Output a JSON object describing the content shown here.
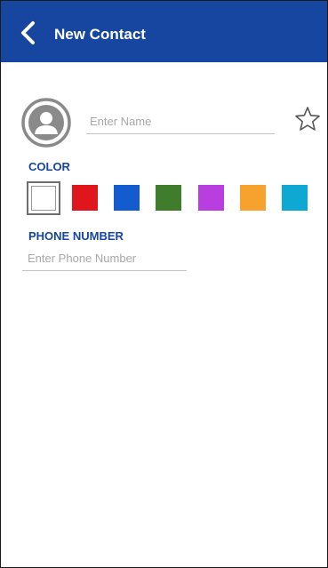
{
  "header": {
    "title": "New Contact",
    "back_icon": "chevron-left-icon",
    "background": "#1646a0"
  },
  "name": {
    "value": "",
    "placeholder": "Enter Name",
    "avatar_icon": "person-avatar-icon",
    "favorite_icon": "star-outline-icon"
  },
  "color": {
    "label": "COLOR",
    "selected_index": 0,
    "swatches": [
      "#ffffff",
      "#e0161d",
      "#145bd0",
      "#3f7d2c",
      "#b93ee0",
      "#f7a12e",
      "#0fa8d2"
    ]
  },
  "phone": {
    "label": "PHONE NUMBER",
    "value": "",
    "placeholder": "Enter Phone Number"
  }
}
